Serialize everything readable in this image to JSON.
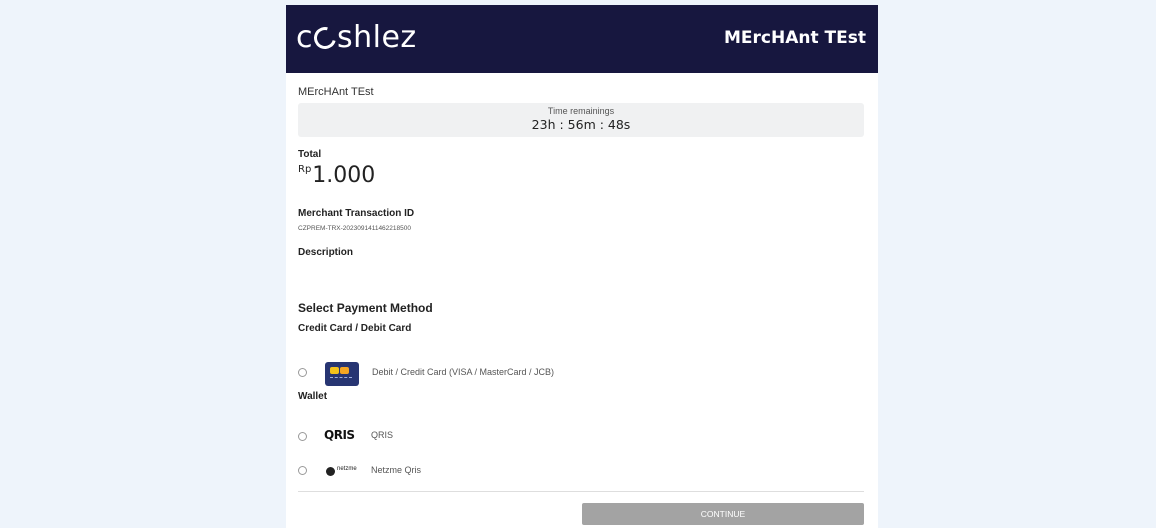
{
  "header": {
    "logo_pre": "c",
    "logo_post": "shlez",
    "merchant": "MErcHAnt TEst"
  },
  "merchant_name": "MErcHAnt TEst",
  "timer": {
    "label": "Time remainings",
    "value": "23h : 56m : 48s"
  },
  "total": {
    "label": "Total",
    "currency": "Rp",
    "amount": "1.000"
  },
  "transaction": {
    "label": "Merchant Transaction ID",
    "id": "CZPREM-TRX-20230914114622185​00"
  },
  "description": {
    "label": "Description"
  },
  "payment": {
    "title": "Select Payment Method",
    "card_group": "Credit Card / Debit Card",
    "card_method": "Debit / Credit Card (VISA / MasterCard / JCB)",
    "wallet_group": "Wallet",
    "qris_logo": "QRIS",
    "qris_method": "QRIS",
    "netzme_logo": "netzme",
    "netzme_method": "Netzme Qris"
  },
  "continue_label": "CONTINUE",
  "colors": {
    "header_bg": "#17173f",
    "button_bg": "#a3a3a3",
    "page_bg": "#eef4fb"
  },
  "icons": {
    "card": "credit-card-icon",
    "qris": "qris-logo-icon",
    "netzme": "netzme-logo-icon"
  }
}
